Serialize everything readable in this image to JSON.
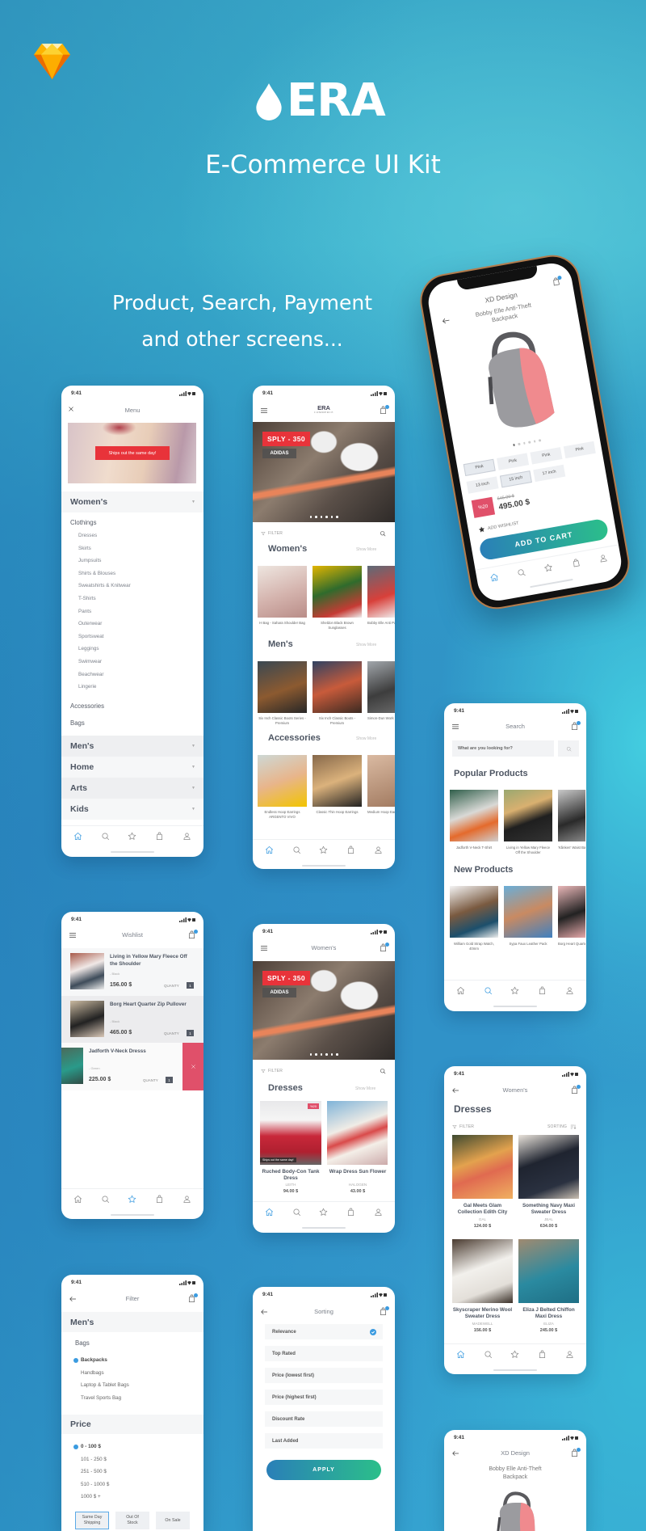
{
  "branding": {
    "app_icon": "sketch-diamond-icon",
    "logo_text": "ERA",
    "subtitle": "E-Commerce UI Kit",
    "tagline_line1": "Product, Search, Payment",
    "tagline_line2": "and other screens..."
  },
  "colors": {
    "accent_blue": "#3b9be0",
    "sale_red": "#e8333a",
    "delete_pink": "#e0506a",
    "button_gradient_start": "#2a7fb8",
    "button_gradient_end": "#2bbf8a",
    "text_dark": "#4d5562"
  },
  "status_time": "9:41",
  "nav_icons": [
    "home-icon",
    "search-icon",
    "star-icon",
    "bag-icon",
    "user-icon"
  ],
  "product": {
    "brand": "XD Design",
    "title": "Bobby Elle Anti-Theft Backpack",
    "colors": [
      {
        "label": "Pink",
        "selected": true
      },
      {
        "label": "Pink",
        "selected": false
      },
      {
        "label": "Pink",
        "selected": false
      },
      {
        "label": "Pink",
        "selected": false
      }
    ],
    "sizes": [
      {
        "label": "13 inch",
        "selected": false
      },
      {
        "label": "15 inch",
        "selected": true
      },
      {
        "label": "17 inch",
        "selected": false
      }
    ],
    "discount": "%20",
    "old_price": "645.00 $",
    "price": "495.00 $",
    "wishlist": "ADD WISHLIST",
    "cart_button": "ADD TO CART",
    "active_nav": 0
  },
  "menu": {
    "title": "Menu",
    "banner_tag": "Ships out the same day!",
    "women": "Women's",
    "clothings": "Clothings",
    "clothing_items": [
      "Dresses",
      "Skirts",
      "Jumpsuits",
      "Shirts & Blouses",
      "Sweatshirts & Knitwear",
      "T-Shirts",
      "Pants",
      "Outerwear",
      "Sportsweat",
      "Leggings",
      "Swimwear",
      "Beachwear",
      "Lingerie"
    ],
    "accessories": "Accessories",
    "bags": "Bags",
    "sections": [
      "Men's",
      "Home",
      "Arts",
      "Kids"
    ],
    "active_nav": 0
  },
  "home": {
    "logo": "ERA",
    "logo_sub": "COMMERCE",
    "hero_tag": "SPLY - 350",
    "hero_brand": "ADIDAS",
    "filter": "FILTER",
    "show_more": "Show More",
    "categories": [
      {
        "title": "Women's",
        "products": [
          "H Bag - Sahara Shoulder Bag",
          "Sheldon Black Brown Sunglasses",
          "Bobby Elle Anti Pasto T"
        ]
      },
      {
        "title": "Men's",
        "products": [
          "Six Inch Classic Boots Series - Premium",
          "Six Inch Classic Boots - Premium",
          "Simon-Dun Work Boots"
        ]
      },
      {
        "title": "Accessories",
        "products": [
          "Endless Hoop Earrings ARGENTO VIVO",
          "Classic Thin Hoop Earrings",
          "Medium Hoop Earrings"
        ]
      }
    ],
    "active_nav": 0
  },
  "search": {
    "title": "Search",
    "placeholder": "What are you looking for?",
    "popular_title": "Popular Products",
    "popular": [
      "Jadforth V-Neck T-Shirt",
      "Living in Yellow Mary Fleece Off the Shoulder",
      "'Kånken' Waist Backpack"
    ],
    "new_title": "New Products",
    "new": [
      "William Gold Strap Watch, 40mm",
      "Sypa Faux Leather Pack",
      "Borg Heart Quarter Zip Pullover"
    ],
    "active_nav": 1
  },
  "wishlist": {
    "title": "Wishlist",
    "quantity_label": "QUANTY",
    "items": [
      {
        "name": "Living in Yellow Mary Fleece Off the Shoulder",
        "variant": "- Black",
        "price": "156.00 $",
        "qty": "1"
      },
      {
        "name": "Borg Heart Quarter Zip Pullover",
        "variant": "- Black",
        "price": "465.00 $",
        "qty": "1"
      },
      {
        "name": "Jadforth V-Neck Dresss",
        "variant": "- Green",
        "price": "225.00 $",
        "qty": "1"
      }
    ],
    "active_nav": 2
  },
  "women": {
    "title": "Women's",
    "hero_tag": "SPLY - 350",
    "hero_brand": "ADIDAS",
    "filter": "FILTER",
    "section_title": "Dresses",
    "show_more": "Show More",
    "products": [
      {
        "name": "Ruched Body-Con Tank Dress",
        "brand": "LEITH",
        "price": "94.00 $",
        "badge": "%20",
        "ship_tag": "Ships out the same day!"
      },
      {
        "name": "Wrap Dress Sun Flower",
        "brand": "HALOGEN",
        "price": "43.00 $"
      }
    ],
    "active_nav": 0
  },
  "dresses": {
    "header": "Women's",
    "title": "Dresses",
    "filter": "FILTER",
    "sorting": "SORTING",
    "products": [
      {
        "name": "Gal Meets Glam Collection Edith City",
        "brand": "GAL",
        "price": "124.00 $"
      },
      {
        "name": "Something Navy Maxi Sweater Dress",
        "brand": "JBAL",
        "price": "634.00 $"
      },
      {
        "name": "Skyscraper Merino Wool Sweater Dress",
        "brand": "MADEWELL",
        "price": "156.00 $"
      },
      {
        "name": "Eliza J Belted Chiffon Maxi Dress",
        "brand": "ELIZA",
        "price": "245.00 $"
      }
    ],
    "active_nav": 0
  },
  "filter": {
    "title": "Filter",
    "category": "Men's",
    "group": "Bags",
    "bag_options": [
      {
        "label": "Backpacks",
        "checked": true
      },
      {
        "label": "Handbags",
        "checked": false
      },
      {
        "label": "Laptop & Tablet Bags",
        "checked": false
      },
      {
        "label": "Travel Sports Bag",
        "checked": false
      }
    ],
    "price_title": "Price",
    "price_options": [
      {
        "label": "0 - 100 $",
        "checked": true
      },
      {
        "label": "101 - 250 $",
        "checked": false
      },
      {
        "label": "251 - 500 $",
        "checked": false
      },
      {
        "label": "510 - 1000 $",
        "checked": false
      },
      {
        "label": "1000 $ +",
        "checked": false
      }
    ],
    "chips": [
      {
        "label": "Same Day Shipping",
        "selected": true
      },
      {
        "label": "Out Of Stock",
        "selected": false
      },
      {
        "label": "On Sale",
        "selected": false
      }
    ]
  },
  "sorting": {
    "title": "Sorting",
    "options": [
      {
        "label": "Relevance",
        "selected": true
      },
      {
        "label": "Top Rated",
        "selected": false
      },
      {
        "label": "Price (lowest first)",
        "selected": false
      },
      {
        "label": "Price (highest first)",
        "selected": false
      },
      {
        "label": "Discount Rate",
        "selected": false
      },
      {
        "label": "Last Added",
        "selected": false
      }
    ],
    "apply": "APPLY"
  },
  "xd": {
    "brand": "XD Design",
    "title": "Bobby Elle Anti-Theft Backpack"
  }
}
